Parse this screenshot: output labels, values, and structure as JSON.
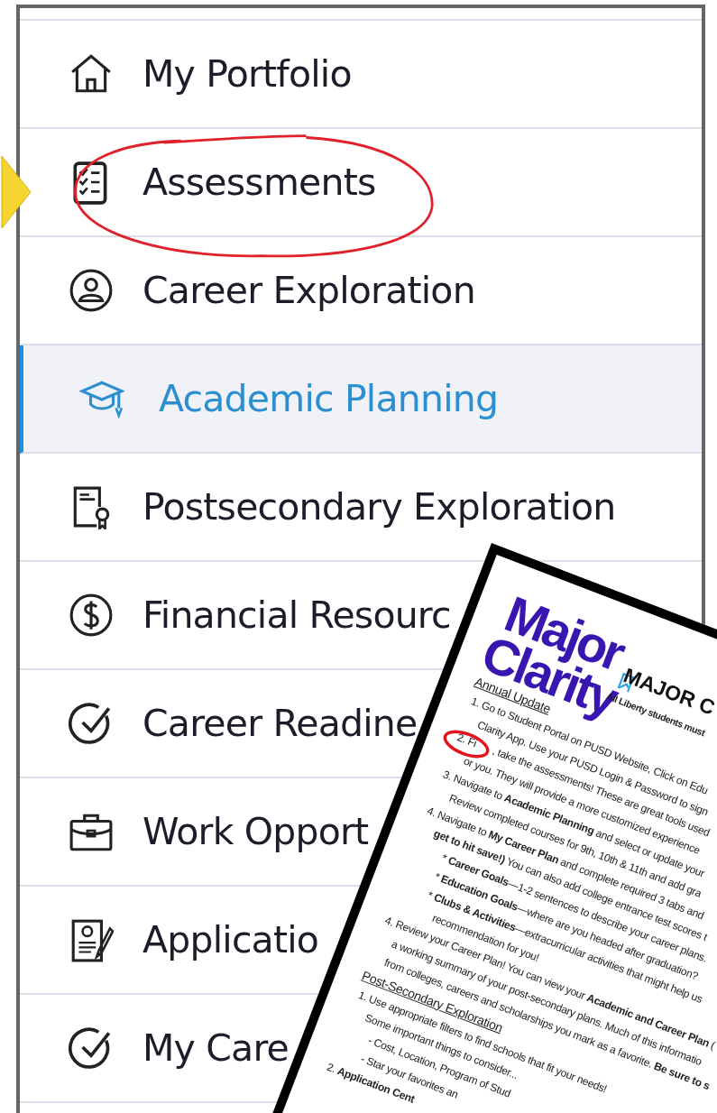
{
  "sidebar": {
    "items": [
      {
        "label": "My Portfolio",
        "selected": false
      },
      {
        "label": "Assessments",
        "selected": false
      },
      {
        "label": "Career Exploration",
        "selected": false
      },
      {
        "label": "Academic Planning",
        "selected": true
      },
      {
        "label": "Postsecondary Exploration",
        "selected": false
      },
      {
        "label": "Financial Resourc",
        "selected": false
      },
      {
        "label": "Career Readine",
        "selected": false
      },
      {
        "label": "Work Opport",
        "selected": false
      },
      {
        "label": "Applicatio",
        "selected": false
      },
      {
        "label": "My Care",
        "selected": false
      }
    ]
  },
  "document": {
    "logo": [
      "Major",
      "Clarity"
    ],
    "title": "MAJOR C",
    "subtitle": "All Liberty students must",
    "lines": [
      {
        "kind": "heading",
        "text": "Annual Update"
      },
      {
        "kind": "item",
        "text": "1.  Go to Student Portal on PUSD Website, Click on Edu"
      },
      {
        "kind": "cont",
        "text": "Clarity App. Use your PUSD Login & Password to sign"
      },
      {
        "kind": "item",
        "text": "2.  Fi",
        "after": ", take the assessments! These are great tools used"
      },
      {
        "kind": "cont",
        "text": "or you. They will provide a more customized experience"
      },
      {
        "kind": "item",
        "text": "3.  Navigate to **Academic Planning** and select or update your"
      },
      {
        "kind": "cont",
        "text": "Review completed courses for 9th, 10th & 11th and add gra"
      },
      {
        "kind": "outer",
        "text": "4.  Navigate to **My Career Plan** and complete required 3 tabs and"
      },
      {
        "kind": "outer-cont",
        "text": "**get to hit save!)** You can also add college entrance test scores t"
      },
      {
        "kind": "bullet",
        "text": "* **Career Goals**—1-2 sentences to describe your career plans."
      },
      {
        "kind": "bullet",
        "text": "* **Education Goals**—where are you headed after graduation?"
      },
      {
        "kind": "bullet",
        "text": "* **Clubs & Activities**—extracurricular activities that might help us"
      },
      {
        "kind": "bullet-cont",
        "text": "recommendation for you!"
      },
      {
        "kind": "outer",
        "text": "4. Review your Career Plan! You can view your **Academic and Career Plan** ("
      },
      {
        "kind": "outer-cont",
        "text": "a working summary of your post-secondary plans. Much of this informatio"
      },
      {
        "kind": "outer-cont",
        "text": "from colleges, careers and scholarships you mark as a favorite. **Be sure to s**"
      },
      {
        "kind": "heading",
        "text": "Post-Secondary Exploration"
      },
      {
        "kind": "item",
        "text": "1.  Use appropriate filters to find schools that fit your needs!"
      },
      {
        "kind": "cont",
        "text": "Some important things to consider..."
      },
      {
        "kind": "sub",
        "text": "- Cost, Location, Program of Stud"
      },
      {
        "kind": "sub",
        "text": "- Star your favorites an"
      },
      {
        "kind": "heading-item",
        "text": "2. **Application Cent**"
      }
    ]
  }
}
